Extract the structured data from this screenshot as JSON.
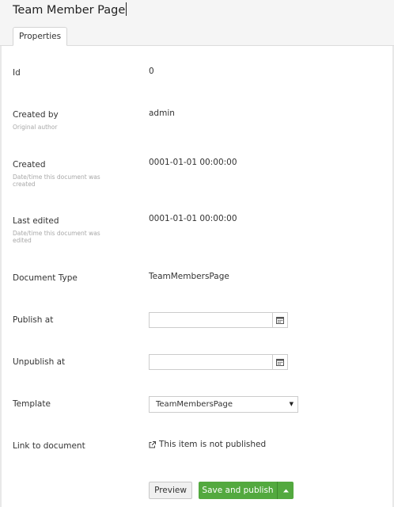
{
  "header": {
    "page_name": "Team Member Page",
    "tabs": [
      {
        "label": "Properties"
      }
    ]
  },
  "properties": {
    "id": {
      "label": "Id",
      "value": "0"
    },
    "created_by": {
      "label": "Created by",
      "description": "Original author",
      "value": "admin"
    },
    "created": {
      "label": "Created",
      "description": "Date/time this document was created",
      "value": "0001-01-01 00:00:00"
    },
    "last_edited": {
      "label": "Last edited",
      "description": "Date/time this document was edited",
      "value": "0001-01-01 00:00:00"
    },
    "document_type": {
      "label": "Document Type",
      "value": "TeamMembersPage"
    },
    "publish_at": {
      "label": "Publish at",
      "value": ""
    },
    "unpublish_at": {
      "label": "Unpublish at",
      "value": ""
    },
    "template": {
      "label": "Template",
      "selected": "TeamMembersPage"
    },
    "link_to_document": {
      "label": "Link to document",
      "value": "This item is not published"
    }
  },
  "actions": {
    "preview_label": "Preview",
    "save_publish_label": "Save and publish"
  },
  "colors": {
    "primary_green": "#53a93f",
    "header_bg": "#f5f5f5"
  },
  "icons": {
    "calendar": "calendar-icon",
    "external_link": "external-link-icon",
    "dropdown": "caret-down-icon"
  }
}
